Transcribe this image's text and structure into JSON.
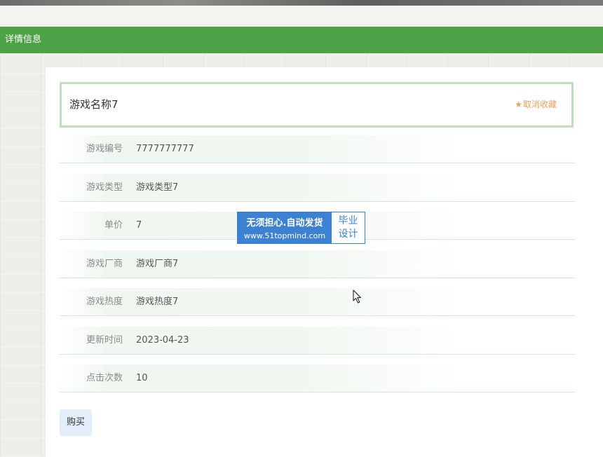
{
  "header": {
    "title": "详情信息"
  },
  "detail": {
    "game_name": "游戏名称7",
    "favorite": {
      "icon": "star-icon",
      "label": "取消收藏",
      "color": "#e8a05d"
    },
    "fields": [
      {
        "label": "游戏编号",
        "value": "7777777777"
      },
      {
        "label": "游戏类型",
        "value": "游戏类型7"
      },
      {
        "label": "单价",
        "value": "7"
      },
      {
        "label": "游戏厂商",
        "value": "游戏厂商7"
      },
      {
        "label": "游戏热度",
        "value": "游戏热度7"
      },
      {
        "label": "更新时间",
        "value": "2023-04-23"
      },
      {
        "label": "点击次数",
        "value": "10"
      }
    ],
    "buy_label": "购买"
  },
  "watermark": {
    "line1": "无须担心.自动发货",
    "line2": "www.51topmind.com",
    "right_line1": "毕业",
    "right_line2": "设计"
  },
  "colors": {
    "header_green": "#4ea147",
    "title_border": "#bfe0bd",
    "buy_button_bg": "#e3eefa"
  }
}
